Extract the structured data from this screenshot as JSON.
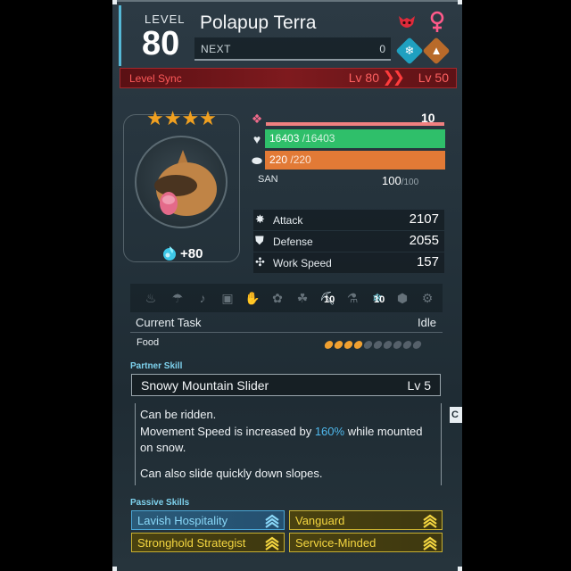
{
  "header": {
    "level_label": "LEVEL",
    "level": "80",
    "pal_name": "Polapup Terra",
    "next_label": "NEXT",
    "next_value": "0"
  },
  "level_sync": {
    "label": "Level Sync",
    "from": "Lv 80",
    "to": "Lv 50"
  },
  "portrait": {
    "stars": "★★★★",
    "condensed_bonus": "+80"
  },
  "stats": {
    "trust_level": "10",
    "hp_current": "16403",
    "hp_max": "/16403",
    "sp_current": "220",
    "sp_max": "/220",
    "san_label": "SAN",
    "san_current": "100",
    "san_max": "/100",
    "attack_label": "Attack",
    "attack_value": "2107",
    "defense_label": "Defense",
    "defense_value": "2055",
    "work_speed_label": "Work Speed",
    "work_speed_value": "157"
  },
  "work_suitability": {
    "mining_level": "10",
    "cooling_level": "10"
  },
  "task": {
    "label": "Current Task",
    "value": "Idle",
    "food_label": "Food",
    "food_filled": 4,
    "food_total": 10
  },
  "partner_skill": {
    "section_title": "Partner Skill",
    "name": "Snowy Mountain Slider",
    "level": "Lv  5",
    "line1": "Can be ridden.",
    "line2_pre": "Movement Speed is increased by ",
    "line2_pct": "160%",
    "line2_post": " while mounted",
    "line3": "on snow.",
    "line4": "Can also slide quickly down slopes.",
    "side_tab": "C"
  },
  "passive_skills": {
    "section_title": "Passive Skills",
    "items": [
      {
        "label": "Lavish Hospitality"
      },
      {
        "label": "Vanguard"
      },
      {
        "label": "Stronghold Strategist"
      },
      {
        "label": "Service-Minded"
      }
    ]
  },
  "colors": {
    "hp": "#2fbf6a",
    "sp": "#e27a36",
    "trust": "#f08080",
    "level_sync": "#7e1a1e",
    "passive_blue": "#4aa6d6",
    "passive_gold": "#c8b030",
    "stars": "#f0a020"
  },
  "icons": {
    "gender": "female-icon",
    "partner_type": "dragon-mask-icon",
    "element_1": "ice-icon",
    "element_2": "ground-icon"
  }
}
